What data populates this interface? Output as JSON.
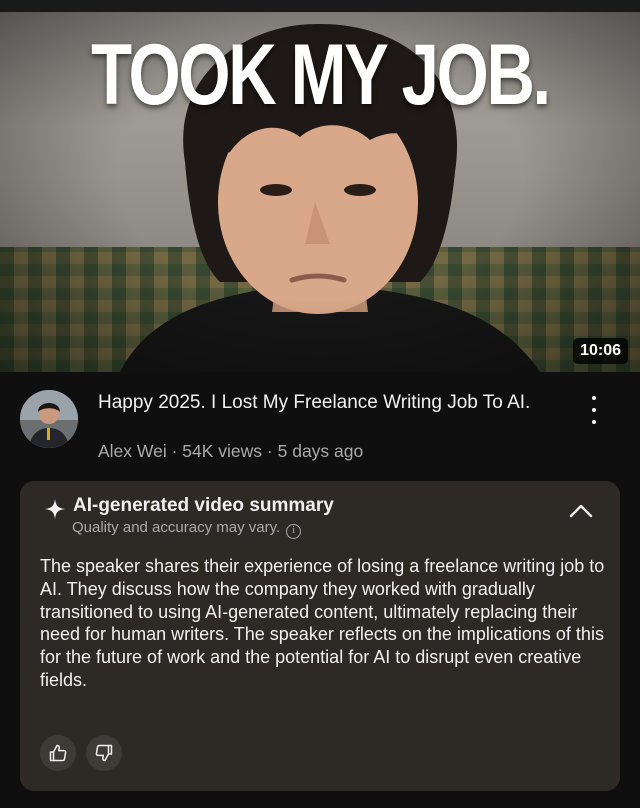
{
  "thumbnail": {
    "overlay_text": "TOOK MY JOB.",
    "duration": "10:06"
  },
  "video": {
    "title": "Happy 2025. I Lost My Freelance Writing Job To AI.",
    "channel": "Alex Wei",
    "views": "54K views",
    "age": "5 days ago",
    "separator": " · "
  },
  "summary": {
    "heading": "AI-generated video summary",
    "disclaimer": "Quality and accuracy may vary.",
    "text": "The speaker shares their experience of losing a freelance writing job to AI. They discuss how the company they worked with gradually transitioned to using AI-generated content, ultimately replacing their need for human writers. The speaker reflects on the implications of this for the future of work and the potential for AI to disrupt even creative fields."
  },
  "icons": {
    "sparkle": "sparkle-icon",
    "info": "info-icon",
    "collapse": "chevron-up-icon",
    "more": "more-vertical-icon",
    "like": "thumbs-up-icon",
    "dislike": "thumbs-down-icon"
  },
  "colors": {
    "background": "#0f0f0f",
    "card": "#2d2a26",
    "secondary_text": "#aaaaaa"
  }
}
